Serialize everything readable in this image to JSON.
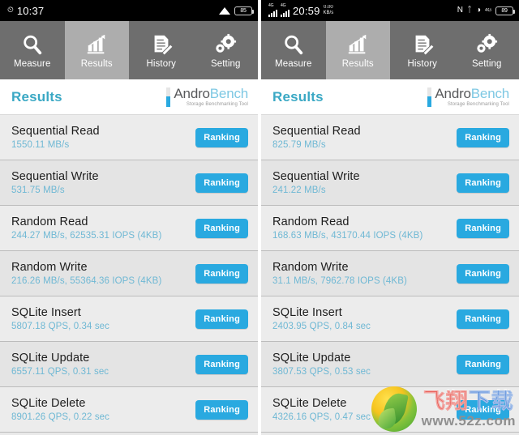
{
  "phones": [
    {
      "id": "left",
      "statusbar": {
        "time": "10:37",
        "left_icons": [
          "alarm-icon"
        ],
        "right_icons": [
          "wifi-icon"
        ],
        "battery": "85"
      },
      "tabs": [
        {
          "label": "Measure",
          "icon": "magnifier-icon",
          "active": false
        },
        {
          "label": "Results",
          "icon": "bar-chart-icon",
          "active": true
        },
        {
          "label": "History",
          "icon": "document-pen-icon",
          "active": false
        },
        {
          "label": "Setting",
          "icon": "gears-icon",
          "active": false
        }
      ],
      "header": {
        "title": "Results",
        "logo_main_a": "Andro",
        "logo_main_b": "Bench",
        "logo_sub": "Storage Benchmarking Tool"
      },
      "rows": [
        {
          "title": "Sequential Read",
          "value": "1550.11 MB/s",
          "button": "Ranking"
        },
        {
          "title": "Sequential Write",
          "value": "531.75 MB/s",
          "button": "Ranking"
        },
        {
          "title": "Random Read",
          "value": "244.27 MB/s, 62535.31 IOPS (4KB)",
          "button": "Ranking"
        },
        {
          "title": "Random Write",
          "value": "216.26 MB/s, 55364.36 IOPS (4KB)",
          "button": "Ranking"
        },
        {
          "title": "SQLite Insert",
          "value": "5807.18 QPS, 0.34 sec",
          "button": "Ranking"
        },
        {
          "title": "SQLite Update",
          "value": "6557.11 QPS, 0.31 sec",
          "button": "Ranking"
        },
        {
          "title": "SQLite Delete",
          "value": "8901.26 QPS, 0.22 sec",
          "button": "Ranking"
        }
      ]
    },
    {
      "id": "right",
      "statusbar": {
        "time": "20:59",
        "net_speed_value": "0.00",
        "net_speed_unit": "KB/s",
        "sim_tag": "4G",
        "left_icons": [
          "signal-icon",
          "signal-icon"
        ],
        "right_icons": [
          "nfc-icon",
          "bluetooth-icon",
          "brightness-icon",
          "data-4g-icon"
        ],
        "battery": "89"
      },
      "tabs": [
        {
          "label": "Measure",
          "icon": "magnifier-icon",
          "active": false
        },
        {
          "label": "Results",
          "icon": "bar-chart-icon",
          "active": true
        },
        {
          "label": "History",
          "icon": "document-pen-icon",
          "active": false
        },
        {
          "label": "Setting",
          "icon": "gears-icon",
          "active": false
        }
      ],
      "header": {
        "title": "Results",
        "logo_main_a": "Andro",
        "logo_main_b": "Bench",
        "logo_sub": "Storage Benchmarking Tool"
      },
      "rows": [
        {
          "title": "Sequential Read",
          "value": "825.79 MB/s",
          "button": "Ranking"
        },
        {
          "title": "Sequential Write",
          "value": "241.22 MB/s",
          "button": "Ranking"
        },
        {
          "title": "Random Read",
          "value": "168.63 MB/s, 43170.44 IOPS (4KB)",
          "button": "Ranking"
        },
        {
          "title": "Random Write",
          "value": "31.1 MB/s, 7962.78 IOPS (4KB)",
          "button": "Ranking"
        },
        {
          "title": "SQLite Insert",
          "value": "2403.95 QPS, 0.84 sec",
          "button": "Ranking"
        },
        {
          "title": "SQLite Update",
          "value": "3807.53 QPS, 0.53 sec",
          "button": "Ranking"
        },
        {
          "title": "SQLite Delete",
          "value": "4326.16 QPS, 0.47 sec",
          "button": "Ranking"
        }
      ]
    }
  ],
  "watermark": {
    "cn_text": "飞翔下载",
    "url": "www.52z.com",
    "logo": "leaf-circle-icon"
  },
  "colors": {
    "accent_blue": "#29a9e0",
    "title_teal": "#3aa8c4",
    "value_blue": "#6fb8d4",
    "tab_bg": "#6e6e6e",
    "tab_active_bg": "#adadad",
    "row_bg": "#ececec"
  }
}
